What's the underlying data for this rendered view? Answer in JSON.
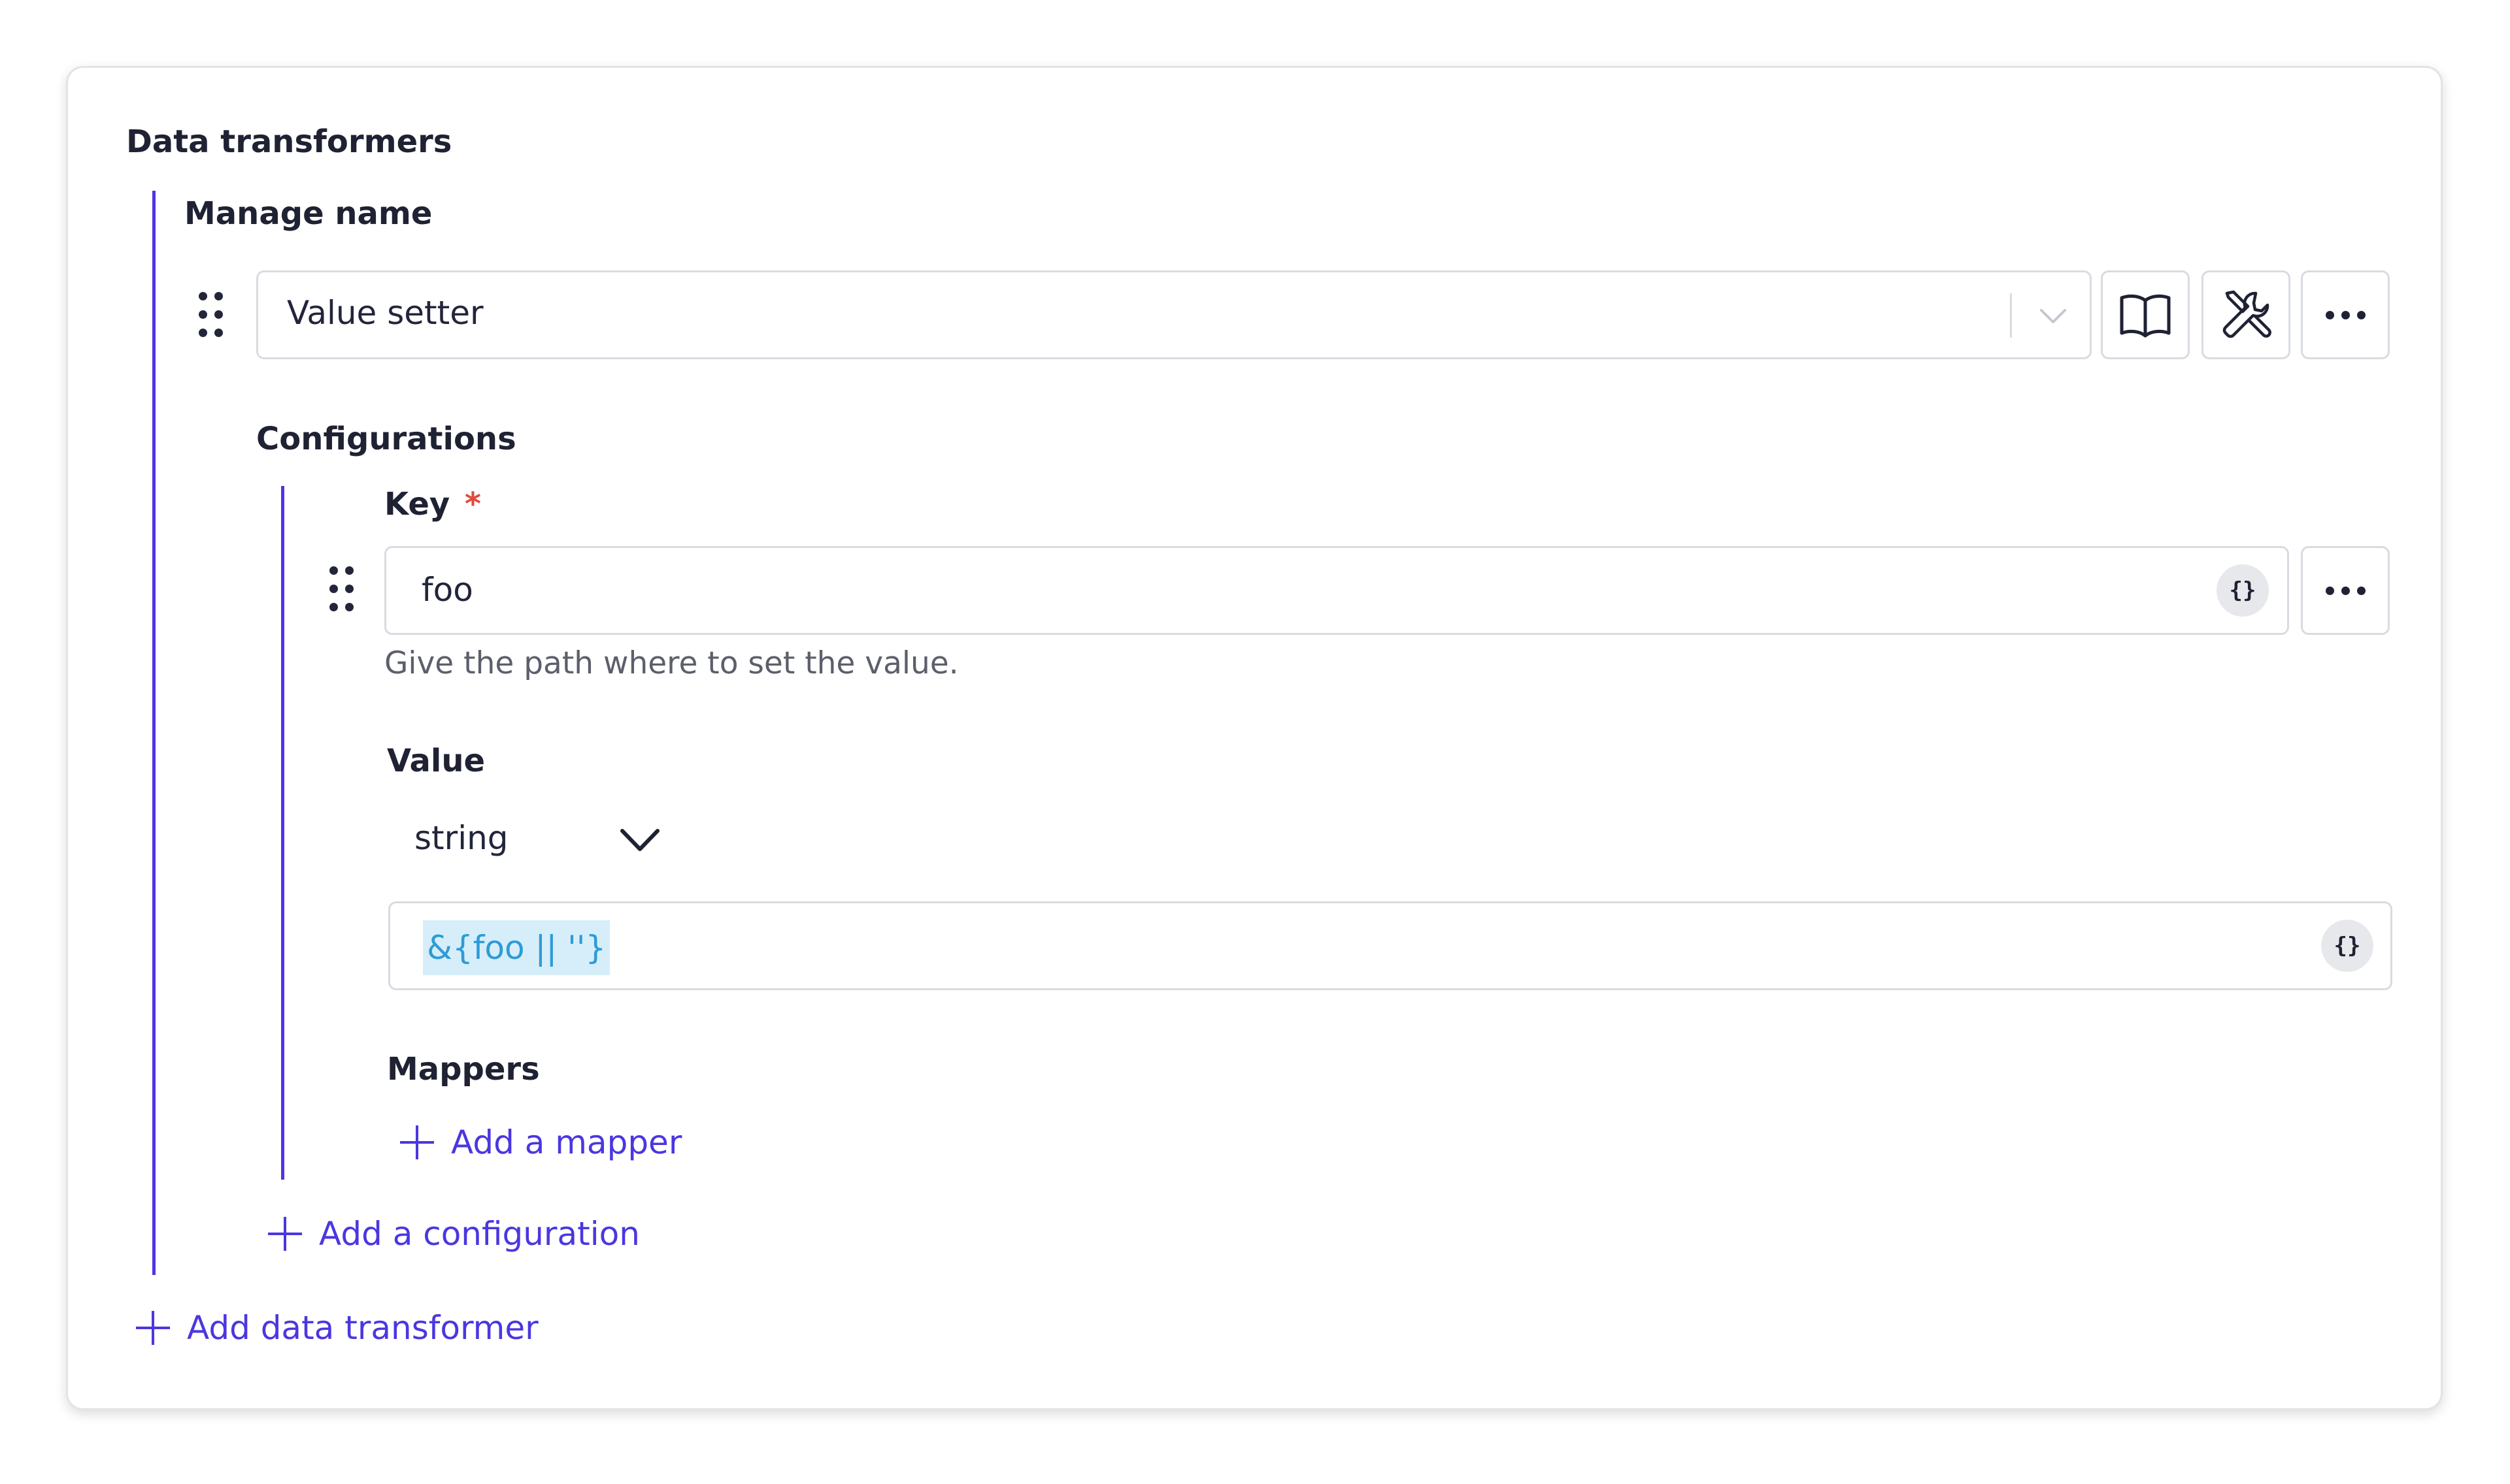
{
  "section_title": "Data transformers",
  "transformer": {
    "name_label": "Manage name",
    "selected_type": "Value setter",
    "buttons": {
      "docs_icon": "book-open-icon",
      "tools_icon": "tools-icon",
      "more_icon": "more-horizontal-icon"
    }
  },
  "configurations": {
    "label": "Configurations",
    "key": {
      "label": "Key",
      "required_mark": "*",
      "value": "foo",
      "brace_badge": "{}",
      "hint": "Give the path where to set the value."
    },
    "value": {
      "label": "Value",
      "type_selected": "string",
      "expression": "&{foo || ''}",
      "brace_badge": "{}"
    },
    "mappers": {
      "label": "Mappers",
      "add_label": "Add a mapper"
    },
    "add_label": "Add a configuration"
  },
  "add_transformer_label": "Add data transformer",
  "colors": {
    "accent": "#4a37e0",
    "tree_line": "#4f35e6",
    "required": "#e5483c",
    "expression_text": "#2e9bd6",
    "expression_highlight": "#d6eef9"
  }
}
